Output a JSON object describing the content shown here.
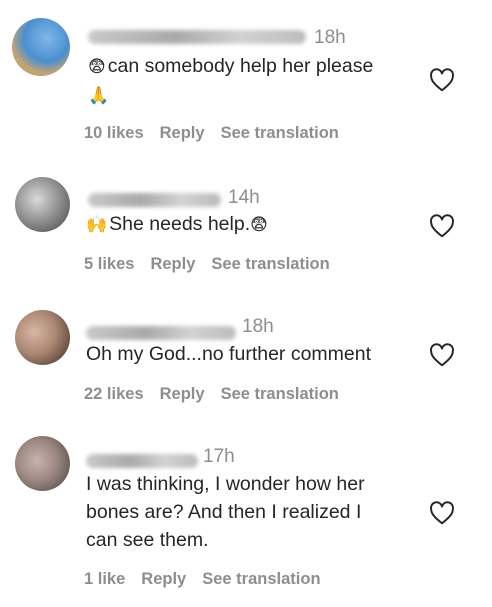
{
  "comments": [
    {
      "time": "18h",
      "text": "can somebody help her please",
      "emoji_lead": "😨",
      "emoji_trail": "🙏",
      "likes": "10 likes",
      "reply": "Reply",
      "translate": "See translation"
    },
    {
      "time": "14h",
      "text": "She needs help.",
      "emoji_lead": "🙌",
      "emoji_trail": "😨",
      "likes": "5 likes",
      "reply": "Reply",
      "translate": "See translation"
    },
    {
      "time": "18h",
      "text": "Oh my God...no further comment",
      "likes": "22 likes",
      "reply": "Reply",
      "translate": "See translation"
    },
    {
      "time": "17h",
      "text_lines": [
        "I was thinking, I wonder how her",
        "bones are? And then I realized I",
        "can see them."
      ],
      "likes": "1 like",
      "reply": "Reply",
      "translate": "See translation"
    }
  ],
  "icons": {
    "like": "heart-outline-icon"
  },
  "colors": {
    "text": "#262626",
    "secondary": "#8e8e8e"
  }
}
